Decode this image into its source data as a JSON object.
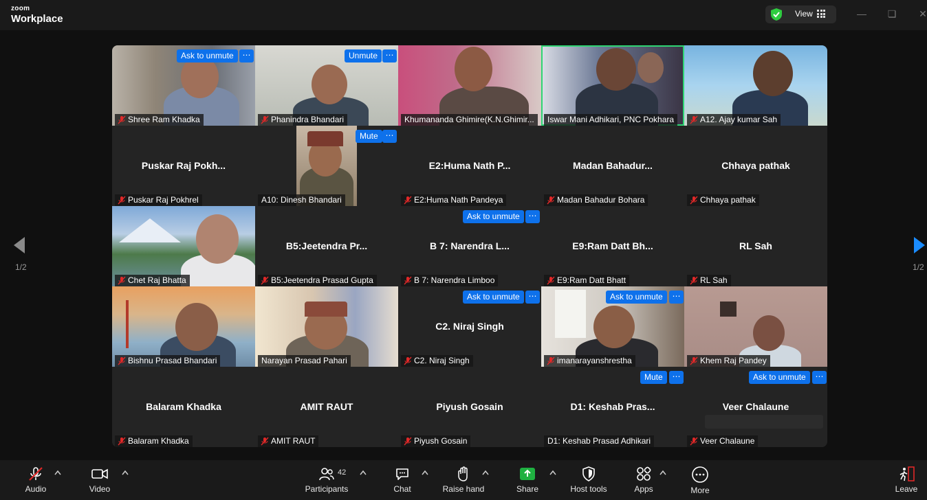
{
  "app": {
    "brand_small": "zoom",
    "brand_big": "Workplace",
    "view_label": "View"
  },
  "pagination": {
    "left": "1/2",
    "right": "1/2"
  },
  "colors": {
    "accent": "#0e71eb",
    "active_speaker": "#2ed573",
    "muted": "#e02828"
  },
  "tiles": [
    {
      "name": "Shree Ram Khadka",
      "badge": "Ask to unmute"
    },
    {
      "name": "Phanindra Bhandari",
      "badge": "Unmute"
    },
    {
      "name": "Khumananda Ghimire(K.N.Ghimir..."
    },
    {
      "name": "Iswar Mani Adhikari, PNC Pokhara"
    },
    {
      "name": "A12. Ajay kumar Sah"
    },
    {
      "name": "Puskar Raj Pokhrel",
      "big": "Puskar  Raj  Pokh..."
    },
    {
      "name": "A10: Dinesh Bhandari",
      "badge": "Mute"
    },
    {
      "name": "E2:Huma Nath Pandeya",
      "big": "E2:Huma  Nath  P..."
    },
    {
      "name": "Madan Bahadur Bohara",
      "big": "Madan  Bahadur..."
    },
    {
      "name": "Chhaya pathak",
      "big": "Chhaya pathak"
    },
    {
      "name": "Chet Raj Bhatta"
    },
    {
      "name": "B5:Jeetendra Prasad Gupta",
      "big": "B5:Jeetendra  Pr..."
    },
    {
      "name": "B 7: Narendra  Limboo",
      "big": "B 7: Narendra  L...",
      "badge": "Ask to unmute"
    },
    {
      "name": "E9:Ram Datt Bhatt",
      "big": "E9:Ram Datt Bh..."
    },
    {
      "name": "RL Sah",
      "big": "RL Sah"
    },
    {
      "name": "Bishnu Prasad Bhandari"
    },
    {
      "name": "Narayan Prasad Pahari"
    },
    {
      "name": "C2. Niraj Singh",
      "big": "C2. Niraj Singh",
      "badge": "Ask to unmute"
    },
    {
      "name": "imanarayanshrestha",
      "badge": "Ask to unmute"
    },
    {
      "name": "Khem Raj Pandey"
    },
    {
      "name": "Balaram Khadka",
      "big": "Balaram Khadka"
    },
    {
      "name": "AMIT RAUT",
      "big": "AMIT RAUT"
    },
    {
      "name": "Piyush Gosain",
      "big": "Piyush Gosain"
    },
    {
      "name": "D1: Keshab Prasad Adhikari",
      "big": "D1:  Keshab  Pras...",
      "badge": "Mute"
    },
    {
      "name": "Veer Chalaune",
      "big": "Veer Chalaune",
      "badge": "Ask to unmute"
    }
  ],
  "toolbar": {
    "audio": "Audio",
    "video": "Video",
    "participants": "Participants",
    "participants_count": "42",
    "chat": "Chat",
    "raise_hand": "Raise hand",
    "share": "Share",
    "host_tools": "Host tools",
    "apps": "Apps",
    "more": "More",
    "leave": "Leave"
  }
}
